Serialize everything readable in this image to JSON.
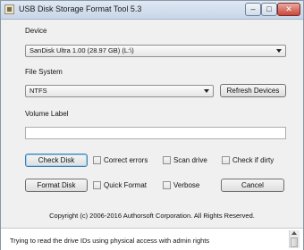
{
  "window": {
    "title": "USB Disk Storage Format Tool 5.3"
  },
  "titlebar_buttons": {
    "minimize": "–",
    "maximize": "□",
    "close": "✕"
  },
  "device": {
    "label": "Device",
    "selected": "SanDisk  Ultra  1.00 (28.97 GB) (L:\\)"
  },
  "file_system": {
    "label": "File System",
    "selected": "NTFS",
    "refresh_button": "Refresh Devices"
  },
  "volume_label": {
    "label": "Volume Label",
    "value": ""
  },
  "actions": {
    "check_disk": "Check Disk",
    "format_disk": "Format Disk",
    "cancel": "Cancel"
  },
  "options": {
    "correct_errors": {
      "label": "Correct errors",
      "checked": false
    },
    "scan_drive": {
      "label": "Scan drive",
      "checked": false
    },
    "check_if_dirty": {
      "label": "Check if dirty",
      "checked": false
    },
    "quick_format": {
      "label": "Quick Format",
      "checked": false
    },
    "verbose": {
      "label": "Verbose",
      "checked": false
    }
  },
  "copyright": "Copyright (c) 2006-2016 Authorsoft Corporation. All Rights Reserved.",
  "log": {
    "line1": "Trying to read the drive IDs using physical access with admin rights"
  }
}
